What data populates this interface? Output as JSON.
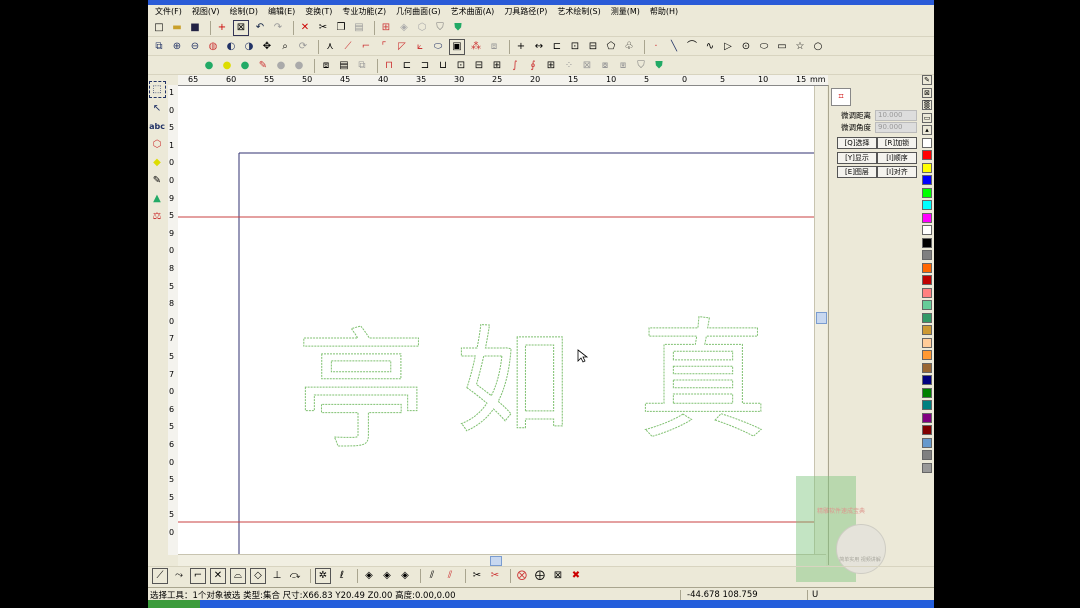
{
  "menu": [
    "文件(F)",
    "视图(V)",
    "绘制(D)",
    "编辑(E)",
    "变换(T)",
    "专业功能(Z)",
    "几何曲面(G)",
    "艺术曲面(A)",
    "刀具路径(P)",
    "艺术绘制(S)",
    "测量(M)",
    "帮助(H)"
  ],
  "ruler": {
    "unit": "mm",
    "x_ticks": [
      "65",
      "60",
      "55",
      "50",
      "45",
      "40",
      "35",
      "30",
      "25",
      "20",
      "15",
      "10",
      "5",
      "0",
      "5",
      "10",
      "15"
    ],
    "y_ticks": [
      "1",
      "0",
      "5",
      "1",
      "0",
      "0",
      "9",
      "5",
      "9",
      "0",
      "8",
      "5",
      "8",
      "0",
      "7",
      "5",
      "7",
      "0",
      "6",
      "5",
      "6",
      "0",
      "5",
      "5",
      "5",
      "0"
    ]
  },
  "panel": {
    "fine_distance_label": "微调距离",
    "fine_distance_value": "10.000",
    "fine_angle_label": "微调角度",
    "fine_angle_value": "90.000",
    "buttons": [
      "[Q]选择",
      "[R]加锁",
      "[Y]显示",
      "[I]顺序",
      "[E]图层",
      "[I]对齐"
    ]
  },
  "canvas_text": [
    "亭",
    "如",
    "真"
  ],
  "status": {
    "left": "选择工具：1个对象被选 类型:集合 尺寸:X66.83 Y20.49 Z0.00 高度:0.00,0.00",
    "coords": "-44.678 108.759",
    "mode": "U"
  },
  "promo": {
    "line1": "精雕软件速成宝典",
    "line2": "简单实用 视频讲解"
  },
  "colors": [
    "#ffffff",
    "#ff0000",
    "#ffff00",
    "#0000ff",
    "#00ff00",
    "#00ffff",
    "#ff00ff",
    "#ffffff",
    "#000000",
    "#808080",
    "#ff6600",
    "#c00000",
    "#ff8080",
    "#66cc99",
    "#339966",
    "#cc9933",
    "#ffcc99",
    "#ff9933",
    "#996633",
    "#000080",
    "#008000",
    "#008080",
    "#800080",
    "#800000",
    "#6699cc",
    "#808080",
    "#999999"
  ]
}
